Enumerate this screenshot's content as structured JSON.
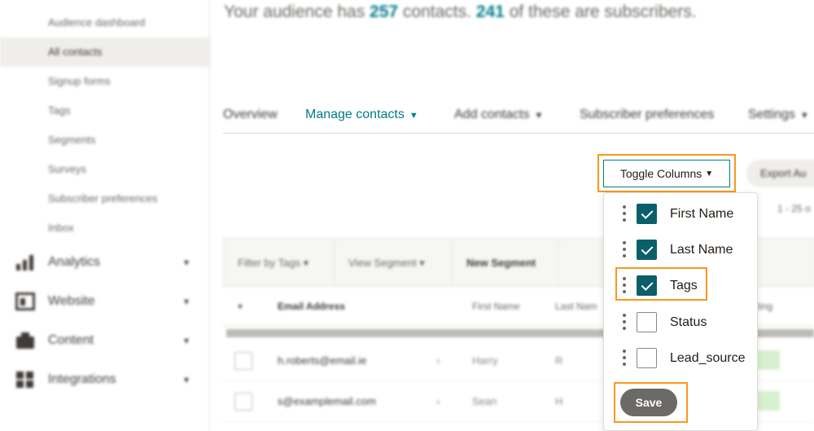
{
  "sidebar": {
    "sub_items": [
      {
        "label": "Audience dashboard"
      },
      {
        "label": "All contacts"
      },
      {
        "label": "Signup forms"
      },
      {
        "label": "Tags"
      },
      {
        "label": "Segments"
      },
      {
        "label": "Surveys"
      },
      {
        "label": "Subscriber preferences"
      },
      {
        "label": "Inbox"
      }
    ],
    "nav_items": [
      {
        "label": "Analytics",
        "icon": "bar-chart-icon"
      },
      {
        "label": "Website",
        "icon": "website-icon"
      },
      {
        "label": "Content",
        "icon": "content-icon"
      },
      {
        "label": "Integrations",
        "icon": "integrations-icon"
      }
    ],
    "chevron": "▾"
  },
  "headline": {
    "prefix": "Your audience has ",
    "contacts": "257",
    "middle": " contacts. ",
    "subscribers": "241",
    "suffix": " of these are subscribers."
  },
  "tabs": [
    {
      "label": "Overview"
    },
    {
      "label": "Manage contacts"
    },
    {
      "label": "Add contacts"
    },
    {
      "label": "Subscriber preferences"
    },
    {
      "label": "Settings"
    }
  ],
  "toolbar": {
    "toggle_label": "Toggle Columns",
    "export_label": "Export Au",
    "paging": "1 - 25 o"
  },
  "table": {
    "filters": {
      "filter_by_tags": "Filter by Tags ▾",
      "view_segment": "View Segment ▾",
      "new_segment": "New Segment"
    },
    "columns": {
      "email": "Email Address",
      "first_name": "First Name",
      "last_name": "Last Nam",
      "rating": "ting"
    },
    "rows": [
      {
        "email": "h.roberts@email.ie",
        "first_name": "Harry",
        "last_name": "R"
      },
      {
        "email": "s@examplemail.com",
        "first_name": "Sean",
        "last_name": "H"
      }
    ]
  },
  "dropdown": {
    "options": [
      {
        "label": "First Name",
        "checked": true
      },
      {
        "label": "Last Name",
        "checked": true
      },
      {
        "label": "Tags",
        "checked": true
      },
      {
        "label": "Status",
        "checked": false
      },
      {
        "label": "Lead_source",
        "checked": false
      }
    ],
    "save_label": "Save"
  },
  "colors": {
    "accent": "#007c89",
    "highlight": "#f7991c",
    "check": "#0b5f6a",
    "save": "#6c6a67"
  }
}
